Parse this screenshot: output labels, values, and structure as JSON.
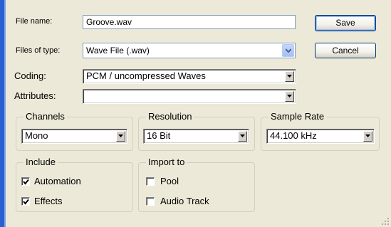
{
  "file_name": {
    "label": "File name:",
    "value": "Groove.wav"
  },
  "files_of_type": {
    "label": "Files of type:",
    "value": "Wave File (.wav)"
  },
  "buttons": {
    "save": "Save",
    "cancel": "Cancel"
  },
  "coding": {
    "label": "Coding:",
    "value": "PCM / uncompressed Waves"
  },
  "attributes": {
    "label": "Attributes:",
    "value": ""
  },
  "channels": {
    "title": "Channels",
    "value": "Mono"
  },
  "resolution": {
    "title": "Resolution",
    "value": "16 Bit"
  },
  "sample_rate": {
    "title": "Sample Rate",
    "value": "44.100 kHz"
  },
  "include": {
    "title": "Include",
    "items": [
      {
        "label": "Automation",
        "checked": true
      },
      {
        "label": "Effects",
        "checked": true
      }
    ]
  },
  "import_to": {
    "title": "Import to",
    "items": [
      {
        "label": "Pool",
        "checked": false
      },
      {
        "label": "Audio Track",
        "checked": false
      }
    ]
  },
  "colors": {
    "accent_bar": "#2a5fd0",
    "background": "#ece9d8"
  }
}
